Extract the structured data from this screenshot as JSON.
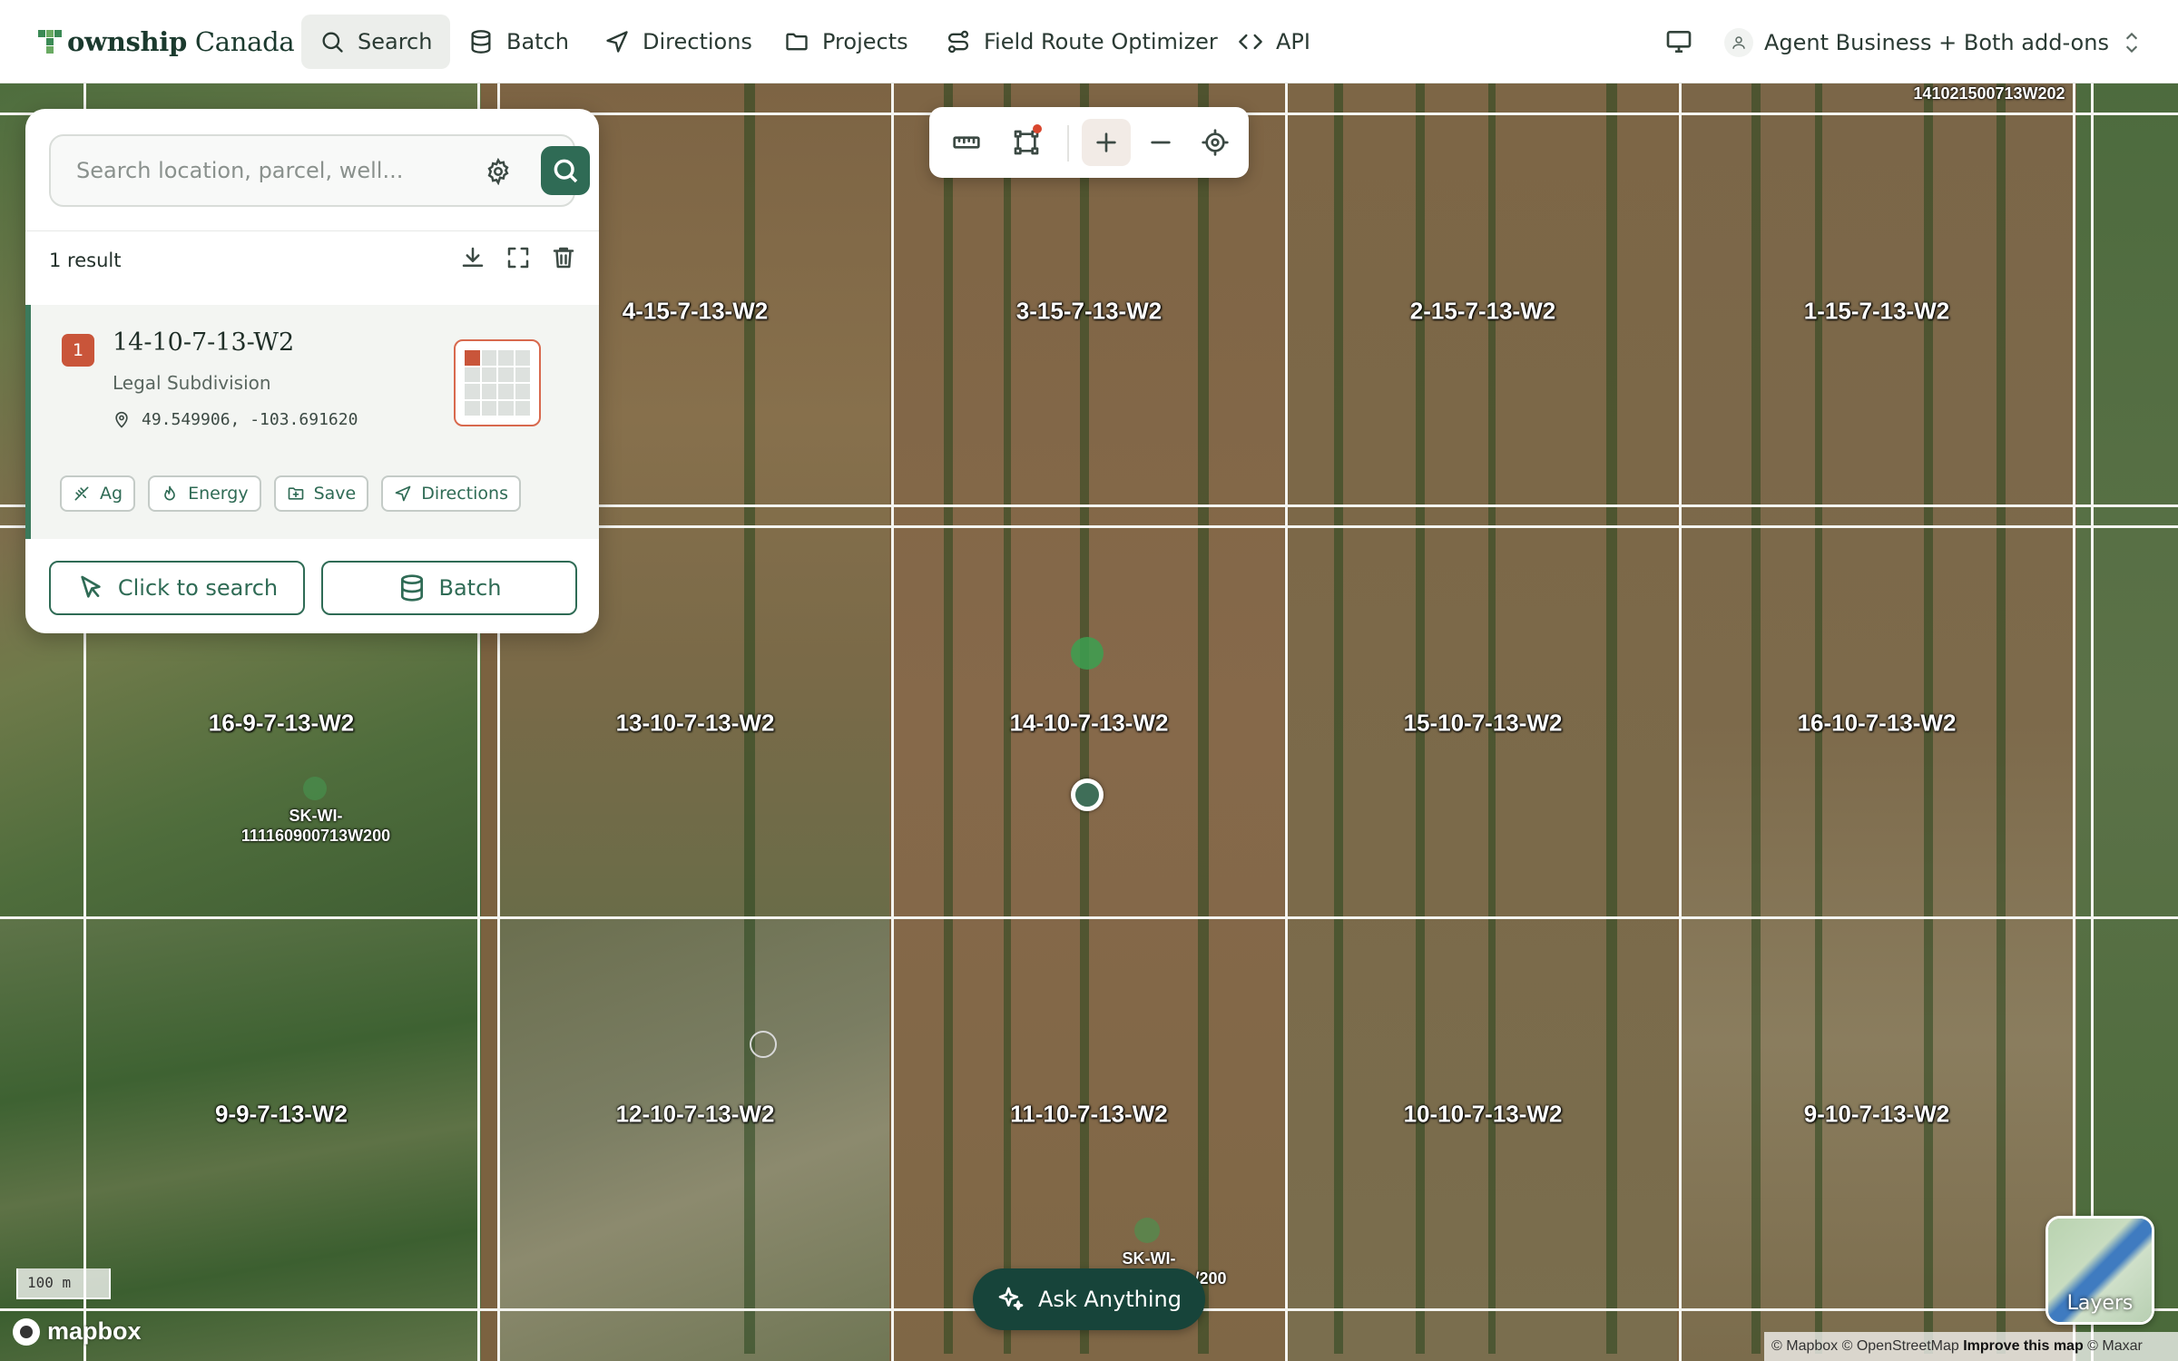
{
  "app": {
    "logo_text_bold": "ownship",
    "logo_text_rest": " Canada"
  },
  "nav": {
    "items": [
      {
        "label": "Search",
        "icon": "search-icon",
        "active": true
      },
      {
        "label": "Batch",
        "icon": "database-icon",
        "active": false
      },
      {
        "label": "Directions",
        "icon": "navigation-icon",
        "active": false
      },
      {
        "label": "Projects",
        "icon": "folder-icon",
        "active": false
      },
      {
        "label": "Field Route Optimizer",
        "icon": "route-icon",
        "active": false
      },
      {
        "label": "API",
        "icon": "code-icon",
        "active": false
      }
    ],
    "account": "Agent Business + Both add-ons"
  },
  "search": {
    "placeholder": "Search location, parcel, well...",
    "result_count": "1 result"
  },
  "result": {
    "number": "1",
    "title": "14-10-7-13-W2",
    "type": "Legal Subdivision",
    "coords": "49.549906, -103.691620",
    "chips": [
      "Ag",
      "Energy",
      "Save",
      "Directions"
    ]
  },
  "actions": {
    "click_to_search": "Click to search",
    "batch": "Batch"
  },
  "map": {
    "parcels": [
      "4-15-7-13-W2",
      "3-15-7-13-W2",
      "2-15-7-13-W2",
      "1-15-7-13-W2",
      "16-9-7-13-W2",
      "13-10-7-13-W2",
      "14-10-7-13-W2",
      "15-10-7-13-W2",
      "16-10-7-13-W2",
      "9-9-7-13-W2",
      "12-10-7-13-W2",
      "11-10-7-13-W2",
      "10-10-7-13-W2",
      "9-10-7-13-W2"
    ],
    "well_top_right": "141021500713W202",
    "well_left_line1": "SK-WI-",
    "well_left_line2": "111160900713W200",
    "well_bottom_line1": "SK-WI-",
    "well_bottom_line2": "/200",
    "scale": "100 m",
    "ask": "Ask Anything",
    "mapbox": "mapbox",
    "layers": "Layers",
    "attribution_plain": "© Mapbox © OpenStreetMap ",
    "attribution_bold": "Improve this map",
    "attribution_end": " © Maxar"
  },
  "colors": {
    "accent": "#2f6b55",
    "badge": "#c9553a",
    "dark_button": "#17443a"
  }
}
